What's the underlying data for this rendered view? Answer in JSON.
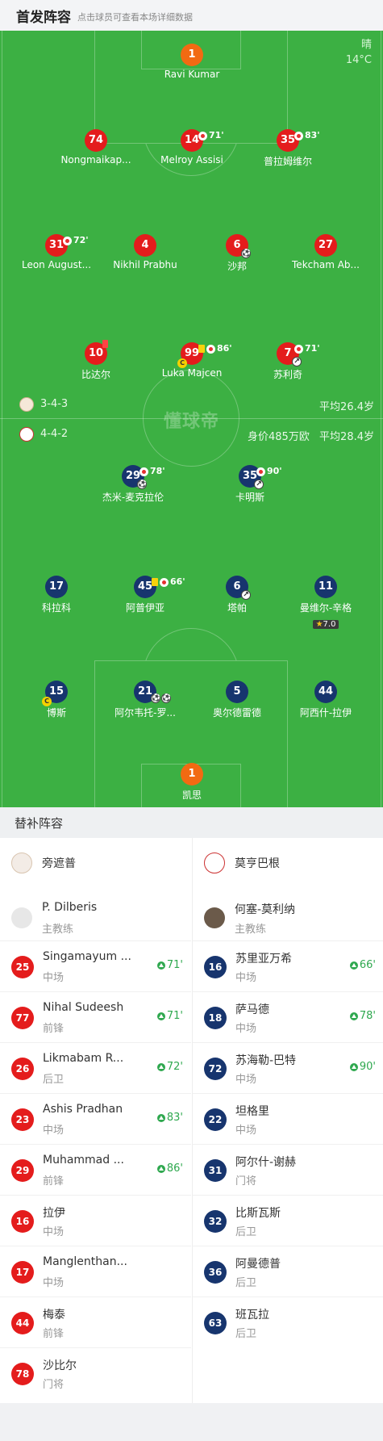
{
  "header": {
    "title": "首发阵容",
    "subtitle": "点击球员可查看本场详细数据"
  },
  "weather": {
    "condition": "晴",
    "temp": "14°C"
  },
  "watermark": "懂球帝",
  "home_team": {
    "formation": "3-4-3",
    "extra": "平均26.4岁"
  },
  "away_team": {
    "formation": "4-4-2",
    "value": "身价485万欧",
    "extra": "平均28.4岁"
  },
  "starters_home": [
    {
      "id": "h1",
      "num": "1",
      "name": "Ravi Kumar",
      "color": "orange"
    },
    {
      "id": "h2",
      "num": "74",
      "name": "Nongmaikap...",
      "color": "red"
    },
    {
      "id": "h3",
      "num": "14",
      "name": "Melroy Assisi",
      "color": "red",
      "sub_min": "71'"
    },
    {
      "id": "h4",
      "num": "35",
      "name": "普拉姆维尔",
      "color": "red",
      "sub_min": "83'"
    },
    {
      "id": "h5",
      "num": "31",
      "name": "Leon August...",
      "color": "red",
      "sub_min": "72'"
    },
    {
      "id": "h6",
      "num": "4",
      "name": "Nikhil Prabhu",
      "color": "red"
    },
    {
      "id": "h7",
      "num": "6",
      "name": "沙邦",
      "color": "red",
      "goal": true
    },
    {
      "id": "h8",
      "num": "27",
      "name": "Tekcham Ab...",
      "color": "red"
    },
    {
      "id": "h9",
      "num": "10",
      "name": "比达尔",
      "color": "red",
      "red_card": true
    },
    {
      "id": "h10",
      "num": "99",
      "name": "Luka Majcen",
      "color": "red",
      "sub_min": "86'",
      "yellow": true,
      "captain": true
    },
    {
      "id": "h11",
      "num": "7",
      "name": "苏利奇",
      "color": "red",
      "sub_min": "71'",
      "assist": true
    }
  ],
  "starters_away": [
    {
      "id": "a1",
      "num": "29",
      "name": "杰米-麦克拉伦",
      "color": "navy",
      "sub_min": "78'",
      "goal": true
    },
    {
      "id": "a2",
      "num": "35",
      "name": "卡明斯",
      "color": "navy",
      "sub_min": "90'",
      "assist": true
    },
    {
      "id": "a3",
      "num": "17",
      "name": "科拉科",
      "color": "navy"
    },
    {
      "id": "a4",
      "num": "45",
      "name": "阿普伊亚",
      "color": "navy",
      "sub_min": "66'",
      "yellow": true
    },
    {
      "id": "a5",
      "num": "6",
      "name": "塔帕",
      "color": "navy",
      "assist": true
    },
    {
      "id": "a6",
      "num": "11",
      "name": "曼维尔-辛格",
      "color": "navy",
      "rating": "7.0"
    },
    {
      "id": "a7",
      "num": "15",
      "name": "博斯",
      "color": "navy",
      "captain": true
    },
    {
      "id": "a8",
      "num": "21",
      "name": "阿尔韦托-罗...",
      "color": "navy",
      "goals": 2
    },
    {
      "id": "a9",
      "num": "5",
      "name": "奥尔德雷德",
      "color": "navy"
    },
    {
      "id": "a10",
      "num": "44",
      "name": "阿西什-拉伊",
      "color": "navy"
    },
    {
      "id": "a11",
      "num": "1",
      "name": "凯思",
      "color": "orange"
    }
  ],
  "subs_title": "替补阵容",
  "home_subs": {
    "team": "旁遮普",
    "coach": {
      "name": "P. Dilberis",
      "role": "主教练"
    },
    "players": [
      {
        "num": "25",
        "name": "Singamayum ...",
        "pos": "中场",
        "min": "71'"
      },
      {
        "num": "77",
        "name": "Nihal Sudeesh",
        "pos": "前锋",
        "min": "71'"
      },
      {
        "num": "26",
        "name": "Likmabam R...",
        "pos": "后卫",
        "min": "72'"
      },
      {
        "num": "23",
        "name": "Ashis Pradhan",
        "pos": "中场",
        "min": "83'"
      },
      {
        "num": "29",
        "name": "Muhammad ...",
        "pos": "前锋",
        "min": "86'"
      },
      {
        "num": "16",
        "name": "拉伊",
        "pos": "中场"
      },
      {
        "num": "17",
        "name": "Manglenthan...",
        "pos": "中场"
      },
      {
        "num": "44",
        "name": "梅泰",
        "pos": "前锋"
      },
      {
        "num": "78",
        "name": "沙比尔",
        "pos": "门将"
      }
    ]
  },
  "away_subs": {
    "team": "莫亨巴根",
    "coach": {
      "name": "何塞-莫利纳",
      "role": "主教练"
    },
    "players": [
      {
        "num": "16",
        "name": "苏里亚万希",
        "pos": "中场",
        "min": "66'"
      },
      {
        "num": "18",
        "name": "萨马德",
        "pos": "中场",
        "min": "78'"
      },
      {
        "num": "72",
        "name": "苏海勒-巴特",
        "pos": "中场",
        "min": "90'"
      },
      {
        "num": "22",
        "name": "坦格里",
        "pos": "中场"
      },
      {
        "num": "31",
        "name": "阿尔什-谢赫",
        "pos": "门将"
      },
      {
        "num": "32",
        "name": "比斯瓦斯",
        "pos": "后卫"
      },
      {
        "num": "36",
        "name": "阿曼德普",
        "pos": "后卫"
      },
      {
        "num": "63",
        "name": "班瓦拉",
        "pos": "后卫"
      }
    ]
  },
  "colors": {
    "pitch": "#3cb043",
    "home": "#e41c1c",
    "away": "#17356e",
    "gk": "#f26a12",
    "sub_in": "#2fa84f"
  }
}
